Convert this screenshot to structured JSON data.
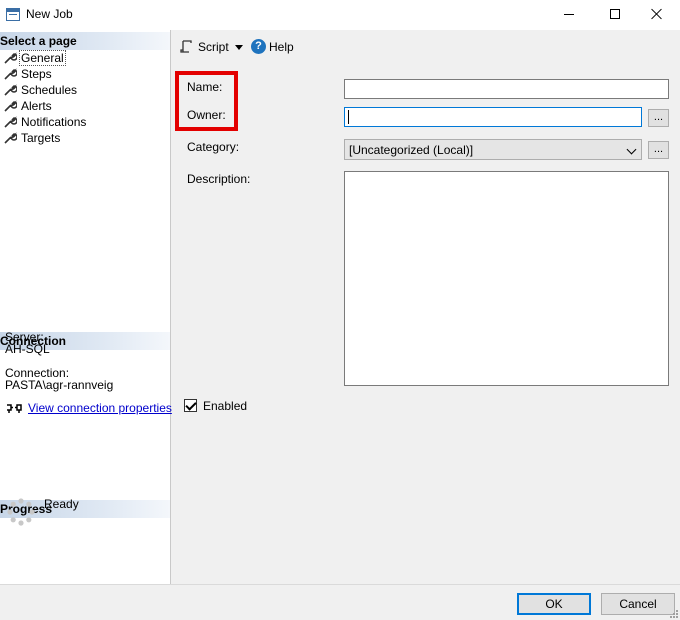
{
  "window": {
    "title": "New Job",
    "controls": [
      "minimize",
      "maximize",
      "close"
    ]
  },
  "sidebar": {
    "select_page_header": "Select a page",
    "pages": [
      {
        "label": "General",
        "selected": true,
        "icon": "wrench-icon"
      },
      {
        "label": "Steps",
        "selected": false,
        "icon": "wrench-icon"
      },
      {
        "label": "Schedules",
        "selected": false,
        "icon": "wrench-icon"
      },
      {
        "label": "Alerts",
        "selected": false,
        "icon": "wrench-icon"
      },
      {
        "label": "Notifications",
        "selected": false,
        "icon": "wrench-icon"
      },
      {
        "label": "Targets",
        "selected": false,
        "icon": "wrench-icon"
      }
    ],
    "connection": {
      "header": "Connection",
      "server_label": "Server:",
      "server_value": "AH-SQL",
      "connection_label": "Connection:",
      "connection_value": "PASTA\\agr-rannveig",
      "link": "View connection properties"
    },
    "progress": {
      "header": "Progress",
      "status": "Ready"
    }
  },
  "toolbar": {
    "script_label": "Script",
    "help_label": "Help"
  },
  "form": {
    "name_label": "Name:",
    "name_value": "",
    "owner_label": "Owner:",
    "owner_value": "",
    "category_label": "Category:",
    "category_value": "[Uncategorized (Local)]",
    "description_label": "Description:",
    "description_value": "",
    "browse_label": "...",
    "enabled_label": "Enabled",
    "enabled": true
  },
  "footer": {
    "ok_label": "OK",
    "cancel_label": "Cancel"
  },
  "colors": {
    "highlight_box": "#e30000",
    "focus_accent": "#0078d7",
    "link": "#0000cc"
  }
}
